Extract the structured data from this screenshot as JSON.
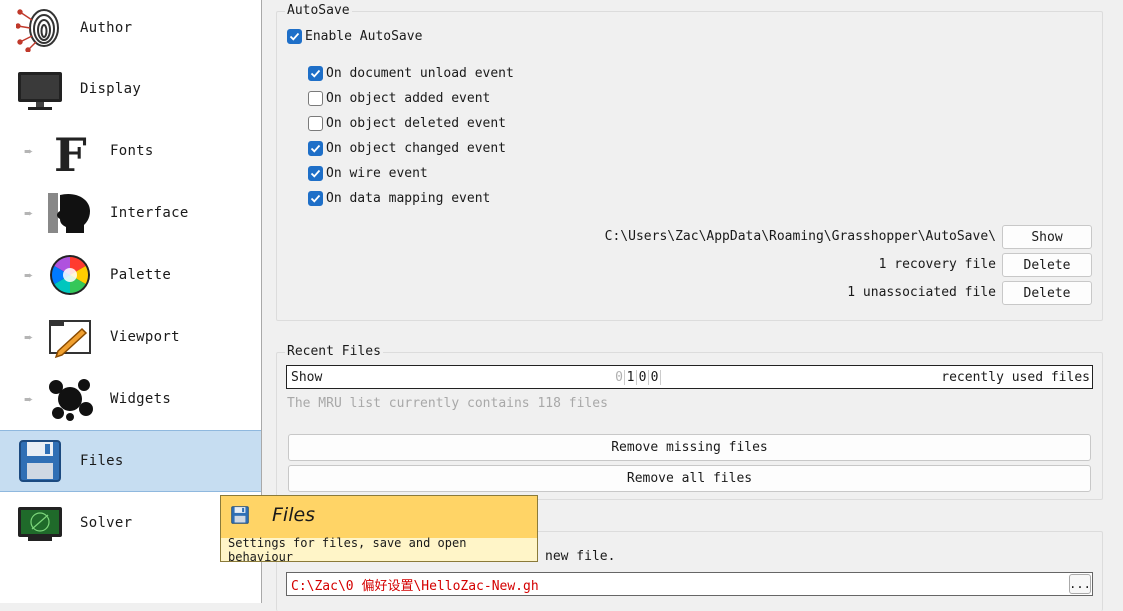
{
  "sidebar": {
    "items": [
      {
        "label": "Author",
        "icon": "fingerprint-icon"
      },
      {
        "label": "Display",
        "icon": "monitor-icon"
      },
      {
        "label": "Fonts",
        "icon": "font-icon"
      },
      {
        "label": "Interface",
        "icon": "head-profile-icon"
      },
      {
        "label": "Palette",
        "icon": "color-wheel-icon"
      },
      {
        "label": "Viewport",
        "icon": "viewport-pencil-icon"
      },
      {
        "label": "Widgets",
        "icon": "splat-icon"
      },
      {
        "label": "Files",
        "icon": "floppy-disk-icon"
      },
      {
        "label": "Solver",
        "icon": "radar-screen-icon"
      }
    ],
    "bullet": "➨"
  },
  "autosave": {
    "title": "AutoSave",
    "enable_label": "Enable AutoSave",
    "enable_checked": true,
    "events": [
      {
        "label": "On document unload event",
        "checked": true
      },
      {
        "label": "On object added event",
        "checked": false
      },
      {
        "label": "On object deleted event",
        "checked": false
      },
      {
        "label": "On object changed event",
        "checked": true
      },
      {
        "label": "On wire event",
        "checked": true
      },
      {
        "label": "On data mapping event",
        "checked": true
      }
    ],
    "path": "C:\\Users\\Zac\\AppData\\Roaming\\Grasshopper\\AutoSave\\",
    "show_label": "Show",
    "recovery_text": "1 recovery file",
    "unassociated_text": "1 unassociated file",
    "delete_label": "Delete"
  },
  "recent": {
    "title": "Recent Files",
    "show_prefix": "Show",
    "digits": [
      "0",
      "1",
      "0",
      "0"
    ],
    "suffix": "recently used files",
    "mru_info": "The MRU list currently contains 118 files",
    "remove_missing": "Remove missing files",
    "remove_all": "Remove all files"
  },
  "template": {
    "partial_text": "new file.",
    "path": "C:\\Zac\\0 偏好设置\\HelloZac-New.gh",
    "browse_label": "..."
  },
  "tooltip": {
    "title": "Files",
    "description": "Settings for files, save and open behaviour"
  },
  "colors": {
    "accent": "#1e6fc8",
    "selected_bg": "#c6ddf1",
    "tooltip_bg": "#ffd466",
    "path_red": "#d40000",
    "muted_text": "#a8a8a8"
  }
}
